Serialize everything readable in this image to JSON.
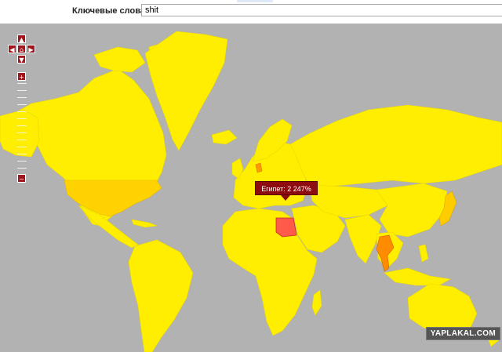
{
  "search": {
    "label": "Ключевые слова:",
    "value": "shit"
  },
  "nav": {
    "up_icon": "chevron-up-icon",
    "down_icon": "chevron-down-icon",
    "left_icon": "chevron-left-icon",
    "right_icon": "chevron-right-icon",
    "center_icon": "home-icon",
    "zoom_in": "+",
    "zoom_out": "−"
  },
  "tooltip": {
    "text": "Египет: 2 247%"
  },
  "watermark": "YAPLAKAL.COM",
  "colors": {
    "ocean": "#b2b2b2",
    "land_low": "#ffee00",
    "land_mid": "#ffcc00",
    "land_high": "#ff8800",
    "land_peak": "#ff5544",
    "accent": "#a3151c"
  }
}
